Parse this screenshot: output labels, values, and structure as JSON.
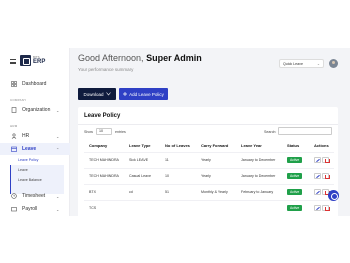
{
  "sidebar": {
    "logo_top": "BITS",
    "logo_bottom": "ERP",
    "dashboard": "Dashboard",
    "company_section": "COMPANY",
    "organization": "Organization",
    "hrm_section": "HRM",
    "hr": "HR",
    "leave": "Leave",
    "leave_sub": [
      "Leave Policy",
      "Leave",
      "Leave Balance"
    ],
    "timesheet": "Timesheet",
    "payroll": "Payroll"
  },
  "header": {
    "greeting": "Good Afternoon,",
    "name": "Super Admin",
    "subtitle": "Your performance summary",
    "quick_select": "Quick Leave"
  },
  "actions": {
    "download": "Download",
    "add": "Add Leave Policy"
  },
  "card": {
    "title": "Leave Policy",
    "show": "Show",
    "entries_value": "10",
    "entries": "entries",
    "search": "Search:"
  },
  "table": {
    "headers": [
      "Company",
      "Leave Type",
      "No of Leaves",
      "Carry Forward",
      "Leave Year",
      "Status",
      "Actions"
    ],
    "rows": [
      [
        "TECH MAHINDRA",
        "Sick LEAVE",
        "11",
        "Yearly",
        "January to December",
        "Active"
      ],
      [
        "TECH MAHINDRA",
        "Casual Leave",
        "10",
        "Yearly",
        "January to December",
        "Active"
      ],
      [
        "BTX",
        "cd",
        "51",
        "Monthly & Yearly",
        "February to January",
        "Active"
      ],
      [
        "TCS",
        "",
        "",
        "",
        "",
        "Active"
      ]
    ]
  },
  "colors": {
    "primary": "#2f40c5",
    "dark": "#0f1b3d",
    "active": "#20a04a"
  }
}
